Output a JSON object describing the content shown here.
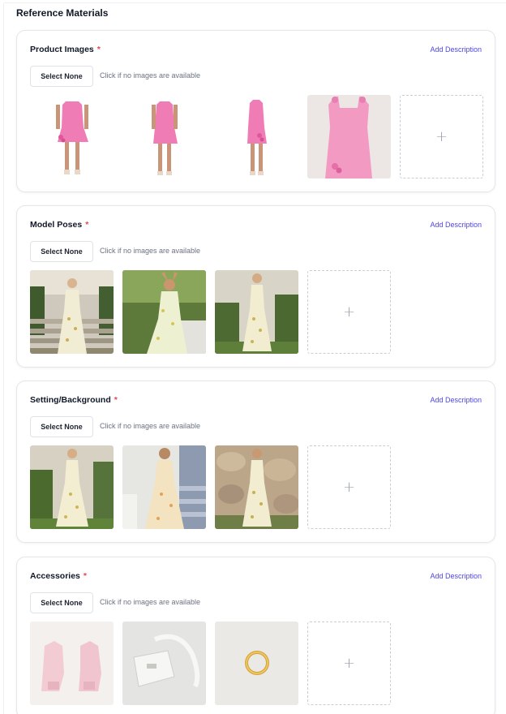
{
  "page": {
    "title": "Reference Materials"
  },
  "common": {
    "add_description": "Add Description",
    "select_none": "Select None",
    "hint": "Click if no images are available",
    "required_mark": "*",
    "add_icon": "+"
  },
  "sections": [
    {
      "title": "Product Images",
      "images": [
        "pink-dress-front",
        "pink-dress-side",
        "pink-dress-back",
        "pink-dress-flatlay"
      ]
    },
    {
      "title": "Model Poses",
      "images": [
        "floral-dress-back-stairs",
        "floral-dress-arms-raised",
        "floral-dress-garden"
      ]
    },
    {
      "title": "Setting/Background",
      "images": [
        "floral-dress-garden-steps",
        "floral-dress-porch",
        "floral-dress-stone-wall"
      ]
    },
    {
      "title": "Accessories",
      "images": [
        "pink-heeled-sandals",
        "white-shoulder-bag",
        "gold-hoop-earring"
      ]
    }
  ],
  "colors": {
    "accent": "#4f46e5",
    "required": "#e5484d",
    "card_border": "#e3e6eb"
  }
}
